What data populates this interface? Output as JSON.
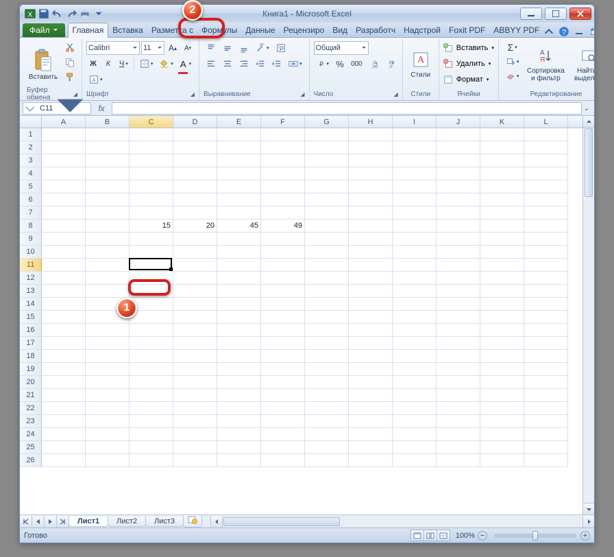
{
  "title": "Книга1  -  Microsoft Excel",
  "qat": {
    "save": "save",
    "undo": "undo",
    "redo": "redo",
    "print": "print",
    "customize": "customize"
  },
  "tabs": {
    "file": "Файл",
    "items": [
      "Главная",
      "Вставка",
      "Разметка с",
      "Формулы",
      "Данные",
      "Рецензиро",
      "Вид",
      "Разработч",
      "Надстрой",
      "Foxit PDF",
      "ABBYY PDF"
    ],
    "active_index": 0,
    "highlighted_index": 3
  },
  "ribbon": {
    "clipboard": {
      "paste": "Вставить",
      "label": "Буфер обмена"
    },
    "font": {
      "name": "Calibri",
      "size": "11",
      "bold": "Ж",
      "italic": "К",
      "underline": "Ч",
      "label": "Шрифт"
    },
    "alignment": {
      "label": "Выравнивание"
    },
    "number": {
      "format": "Общий",
      "label": "Число"
    },
    "styles": {
      "styles": "Стили",
      "label": "Стили"
    },
    "cells": {
      "insert": "Вставить",
      "delete": "Удалить",
      "format": "Формат",
      "label": "Ячейки"
    },
    "editing": {
      "sort": "Сортировка и фильтр",
      "find": "Найти и выделить",
      "label": "Редактирование"
    }
  },
  "namebox": "C11",
  "fx": "fx",
  "columns": [
    "A",
    "B",
    "C",
    "D",
    "E",
    "F",
    "G",
    "H",
    "I",
    "J",
    "K",
    "L"
  ],
  "rows": [
    "1",
    "2",
    "3",
    "4",
    "5",
    "6",
    "7",
    "8",
    "9",
    "10",
    "11",
    "12",
    "13",
    "14",
    "15",
    "16",
    "17",
    "18",
    "19",
    "20",
    "21",
    "22",
    "23",
    "24",
    "25",
    "26"
  ],
  "data": {
    "C8": "15",
    "D8": "20",
    "E8": "45",
    "F8": "49"
  },
  "active_cell": "C11",
  "sheets": {
    "list": [
      "Лист1",
      "Лист2",
      "Лист3"
    ],
    "active_index": 0
  },
  "status": {
    "ready": "Готово",
    "zoom": "100%"
  },
  "markers": {
    "m1": "1",
    "m2": "2"
  }
}
